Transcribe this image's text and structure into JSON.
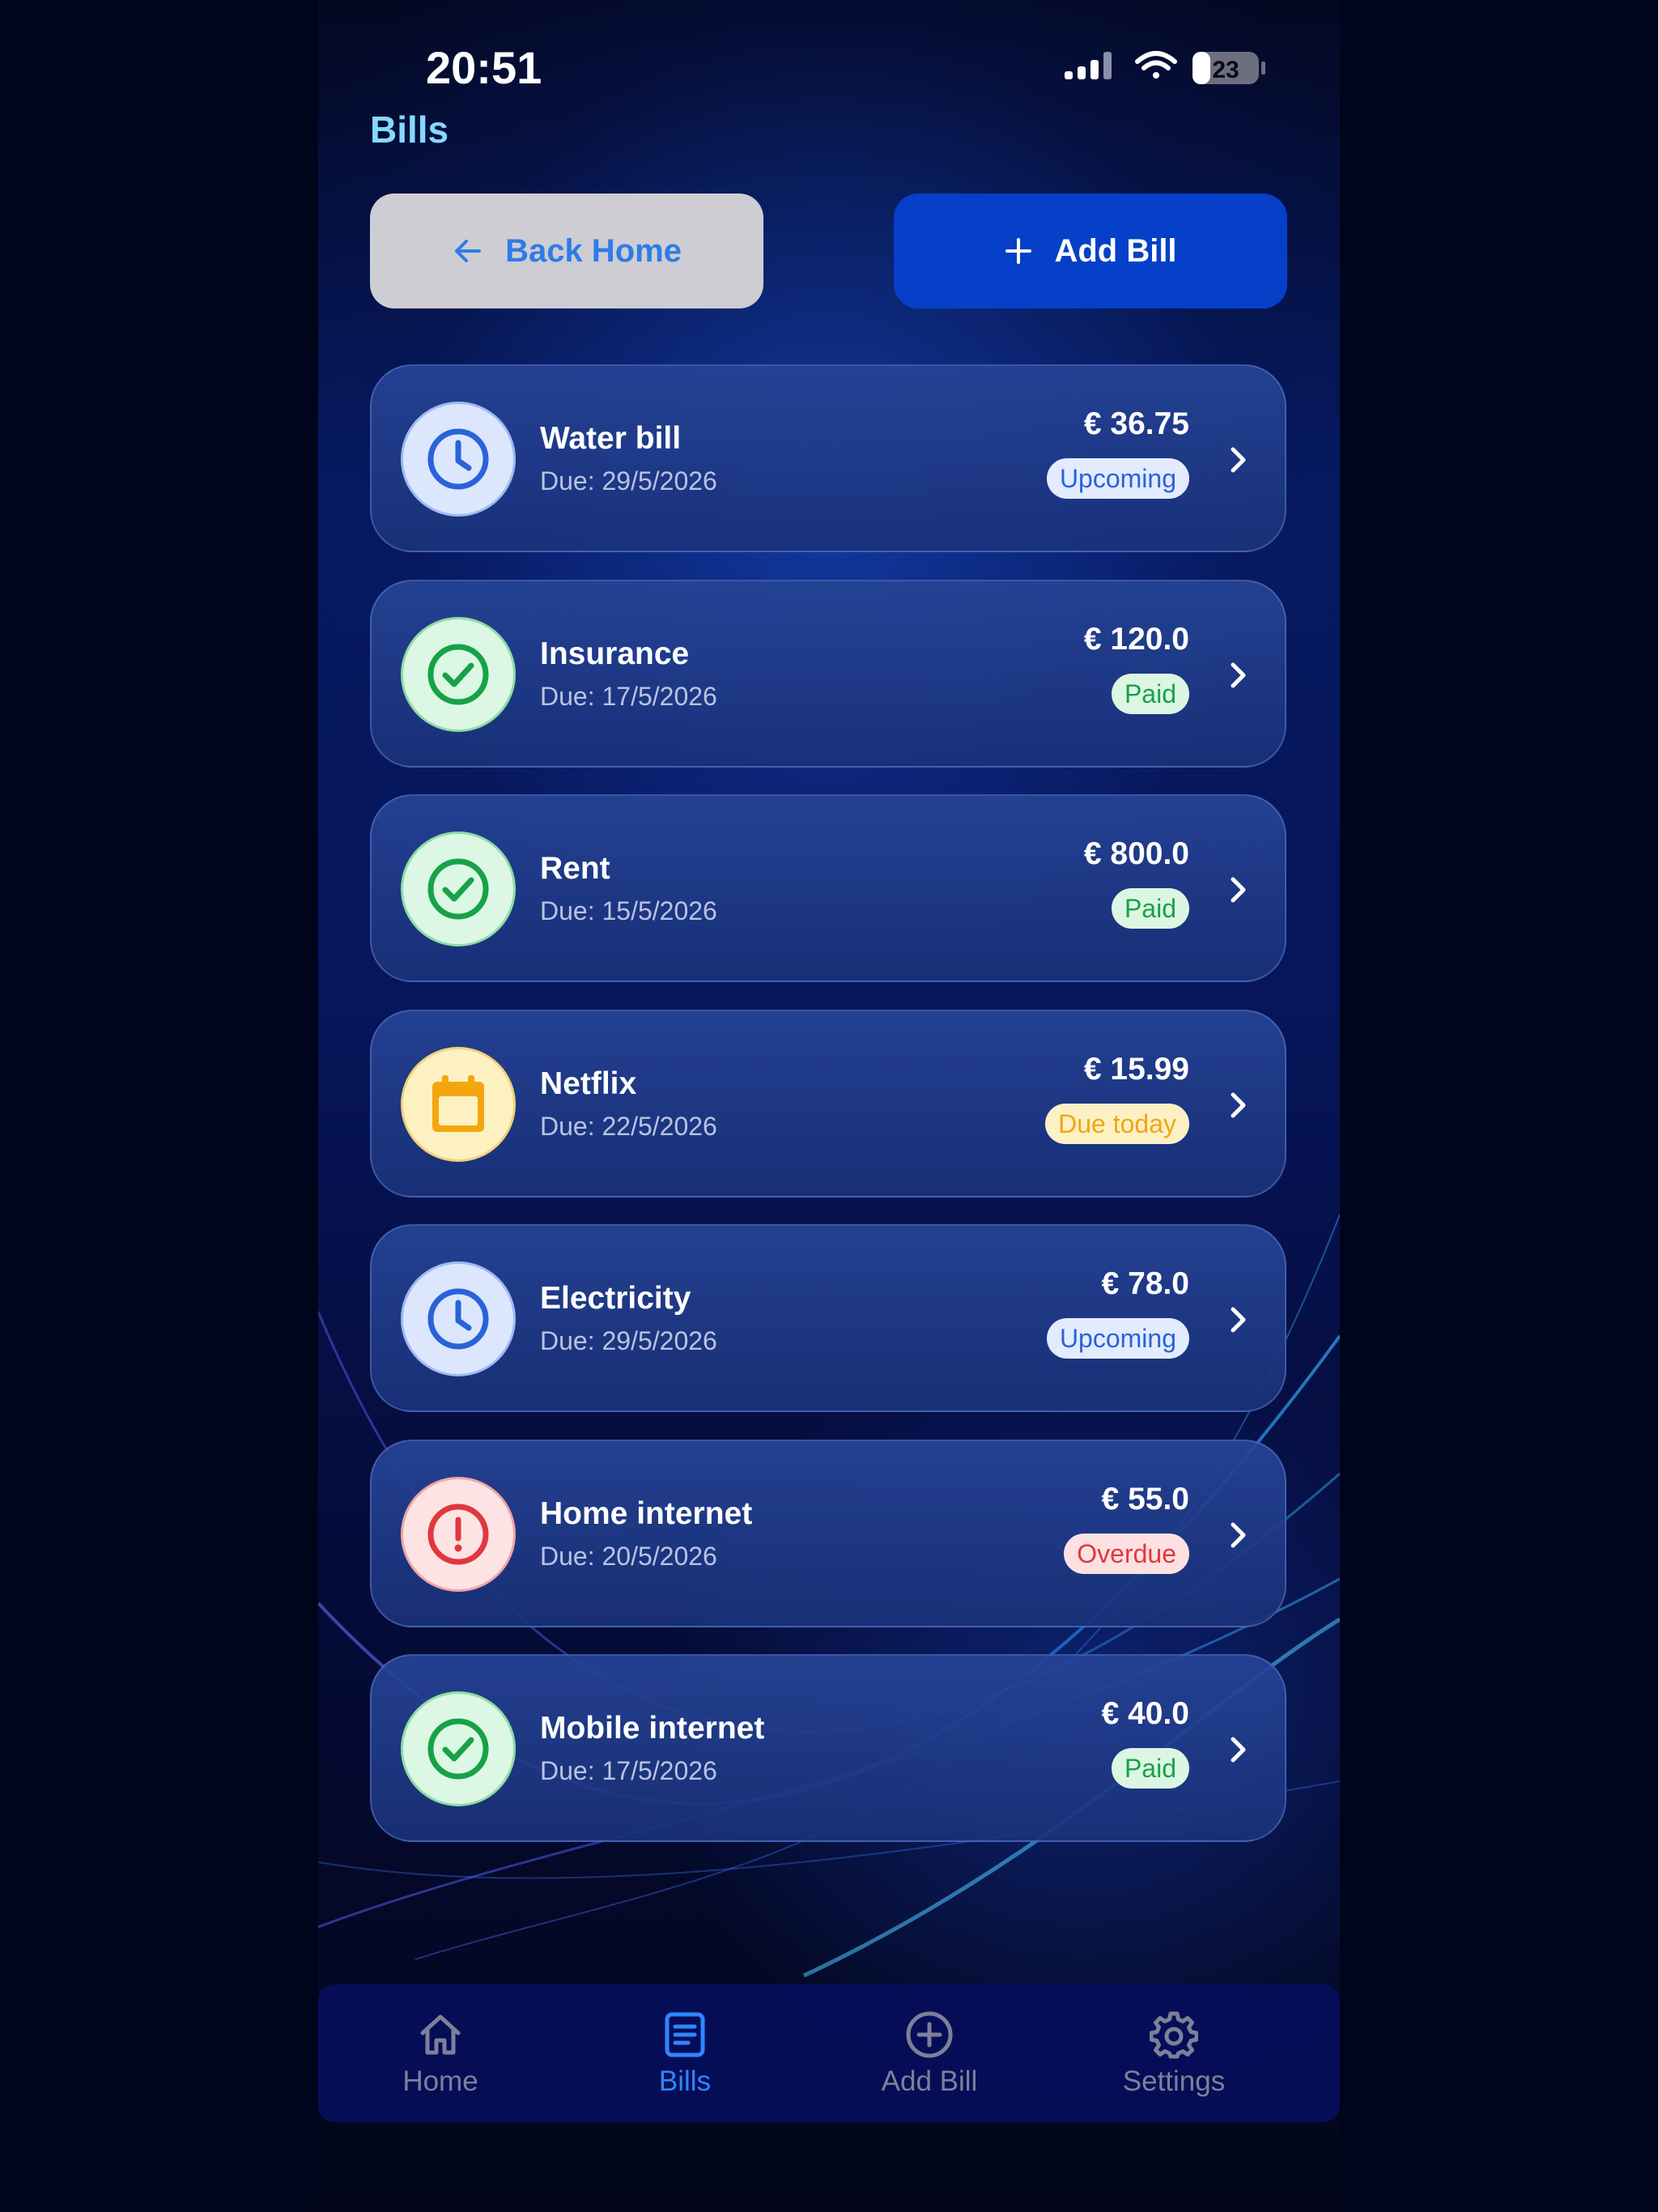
{
  "status_bar": {
    "time": "20:51",
    "battery": "23"
  },
  "header": {
    "title": "Bills"
  },
  "actions": {
    "back_label": "Back Home",
    "add_label": "Add Bill"
  },
  "bills": [
    {
      "name": "Water bill",
      "due": "Due: 29/5/2026",
      "amount": "€ 36.75",
      "status": "Upcoming",
      "icon": "clock-icon"
    },
    {
      "name": "Insurance",
      "due": "Due: 17/5/2026",
      "amount": "€ 120.0",
      "status": "Paid",
      "icon": "check-circle-icon"
    },
    {
      "name": "Rent",
      "due": "Due: 15/5/2026",
      "amount": "€ 800.0",
      "status": "Paid",
      "icon": "check-circle-icon"
    },
    {
      "name": "Netflix",
      "due": "Due: 22/5/2026",
      "amount": "€ 15.99",
      "status": "Due today",
      "icon": "calendar-icon"
    },
    {
      "name": "Electricity",
      "due": "Due: 29/5/2026",
      "amount": "€ 78.0",
      "status": "Upcoming",
      "icon": "clock-icon"
    },
    {
      "name": "Home internet",
      "due": "Due: 20/5/2026",
      "amount": "€ 55.0",
      "status": "Overdue",
      "icon": "alert-circle-icon"
    },
    {
      "name": "Mobile internet",
      "due": "Due: 17/5/2026",
      "amount": "€ 40.0",
      "status": "Paid",
      "icon": "check-circle-icon"
    }
  ],
  "status_colors": {
    "Upcoming": {
      "fg": "#2a62d9",
      "bg": "#e3ebff",
      "circle": "#dce7fd",
      "ring": "#9fbaf3"
    },
    "Paid": {
      "fg": "#17a247",
      "bg": "#dcf6e3",
      "circle": "#dcf8e4",
      "ring": "#8fdca6"
    },
    "Due today": {
      "fg": "#f2a70e",
      "bg": "#fdf0c5",
      "circle": "#fdf1c2",
      "ring": "#f1d27a"
    },
    "Overdue": {
      "fg": "#e0383e",
      "bg": "#fde1e2",
      "circle": "#fde3e4",
      "ring": "#f2a3a6"
    }
  },
  "tabs": [
    {
      "label": "Home",
      "icon": "home-icon",
      "active": false
    },
    {
      "label": "Bills",
      "icon": "document-icon",
      "active": true
    },
    {
      "label": "Add Bill",
      "icon": "plus-circle-icon",
      "active": false
    },
    {
      "label": "Settings",
      "icon": "gear-icon",
      "active": false
    }
  ],
  "colors": {
    "accent": "#0640c8",
    "active_tab": "#2e86ff",
    "inactive_tab": "#7d8098"
  }
}
